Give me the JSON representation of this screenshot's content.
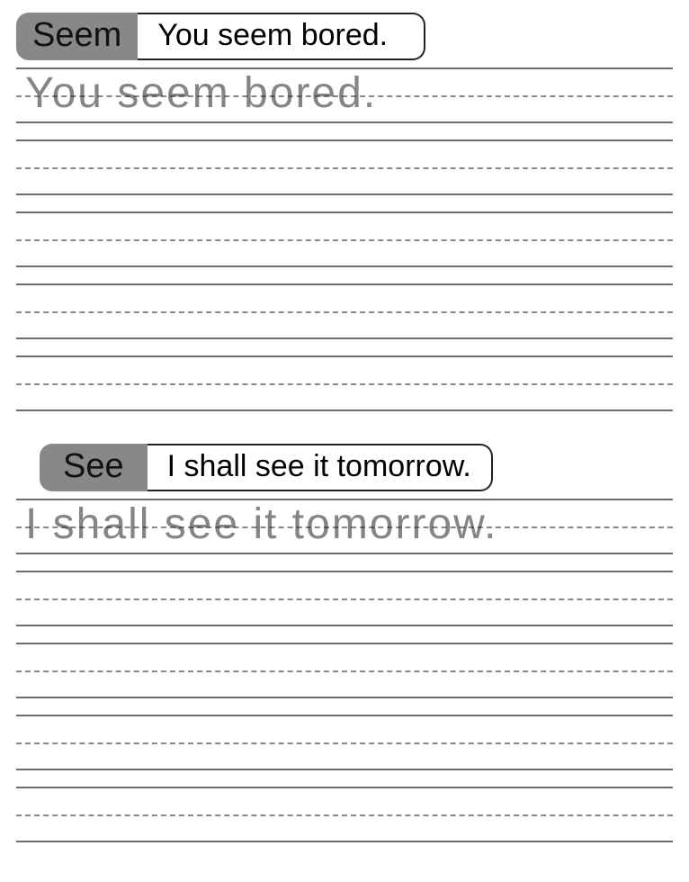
{
  "sections": [
    {
      "word": "Seem",
      "sentence": "You seem bored.",
      "trace": "You seem bored."
    },
    {
      "word": "See",
      "sentence": "I shall see it tomorrow.",
      "trace": "I shall see it tomorrow."
    }
  ]
}
